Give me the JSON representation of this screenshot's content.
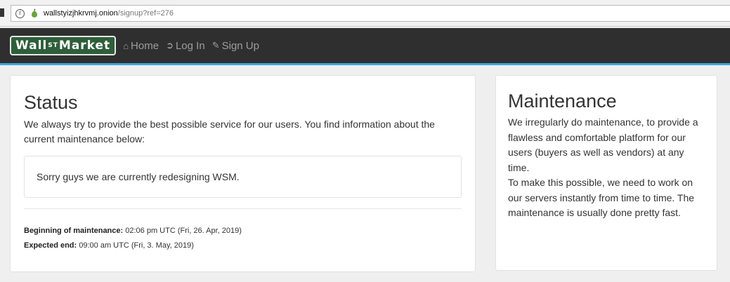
{
  "browser": {
    "url_host": "wallstyizjhkrvmj.onion",
    "url_path": "/signup?ref=276"
  },
  "navbar": {
    "brand": {
      "pre": "Wall",
      "sup": "ST",
      "post": " Market"
    },
    "items": [
      {
        "label": "Home",
        "icon": "home-icon"
      },
      {
        "label": "Log In",
        "icon": "login-icon"
      },
      {
        "label": "Sign Up",
        "icon": "pencil-icon"
      }
    ]
  },
  "status": {
    "title": "Status",
    "lead": "We always try to provide the best possible service for our users. You find information about the current maintenance below:",
    "notice": "Sorry guys we are currently redesigning WSM.",
    "begin_label": "Beginning of maintenance:",
    "begin_value": " 02:06 pm UTC (Fri, 26. Apr, 2019)",
    "end_label": "Expected end:",
    "end_value": " 09:00 am UTC (Fri, 3. May, 2019)"
  },
  "maintenance": {
    "title": "Maintenance",
    "para1": "We irregularly do maintenance, to provide a flawless and comfortable platform for our users (buyers as well as vendors) at any time.",
    "para2": "To make this possible, we need to work on our servers instantly from time to time. The maintenance is usually done pretty fast."
  }
}
